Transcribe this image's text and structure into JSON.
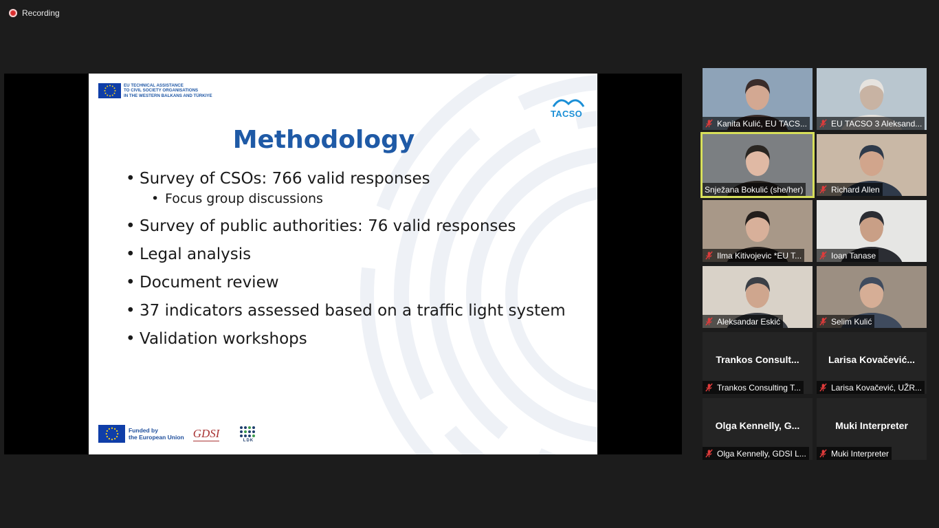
{
  "recording": {
    "label": "Recording"
  },
  "slide": {
    "header_lines": [
      "EU TECHNICAL ASSISTANCE",
      "TO CIVIL SOCIETY ORGANISATIONS",
      "IN THE WESTERN BALKANS AND TÜRKIYE"
    ],
    "logo_text": "TACSO",
    "title": "Methodology",
    "bullets": {
      "b1": "Survey of CSOs: 766 valid responses",
      "b1_sub": "Focus group discussions",
      "b2": "Survey of public authorities: 76 valid responses",
      "b3": "Legal analysis",
      "b4": "Document review",
      "b5": "37 indicators assessed based on a traffic light system",
      "b6": "Validation workshops"
    },
    "footer": {
      "funded_line1": "Funded by",
      "funded_line2": "the European Union",
      "gdsi": "GDSI",
      "ldk": "LDK"
    }
  },
  "participants": [
    {
      "name": "Kanita Kulić, EU TACS...",
      "muted": true,
      "video": true
    },
    {
      "name": "EU TACSO 3 Aleksand...",
      "muted": true,
      "video": true
    },
    {
      "name": "Snježana Bokulić (she/her)",
      "muted": false,
      "video": true,
      "active_speaker": true
    },
    {
      "name": "Richard Allen",
      "muted": true,
      "video": true
    },
    {
      "name": "Ilma Kitivojevic *EU T...",
      "muted": true,
      "video": true
    },
    {
      "name": "Ioan Tanase",
      "muted": true,
      "video": true
    },
    {
      "name": "Aleksandar Eskić",
      "muted": true,
      "video": true
    },
    {
      "name": "Selim Kulić",
      "muted": true,
      "video": true
    },
    {
      "name": "Trankos Consulting T...",
      "display": "Trankos  Consult...",
      "muted": true,
      "video": false
    },
    {
      "name": "Larisa Kovačević, UŽR...",
      "display": "Larisa  Kovačević...",
      "muted": true,
      "video": false
    },
    {
      "name": "Olga Kennelly, GDSI L...",
      "display": "Olga  Kennelly,  G...",
      "muted": true,
      "video": false
    },
    {
      "name": "Muki Interpreter",
      "display": "Muki Interpreter",
      "muted": true,
      "video": false
    }
  ],
  "colors": {
    "accent_speaker": "#d8e05a",
    "muted_icon": "#e03b3b",
    "title_blue": "#1f5aa6"
  }
}
